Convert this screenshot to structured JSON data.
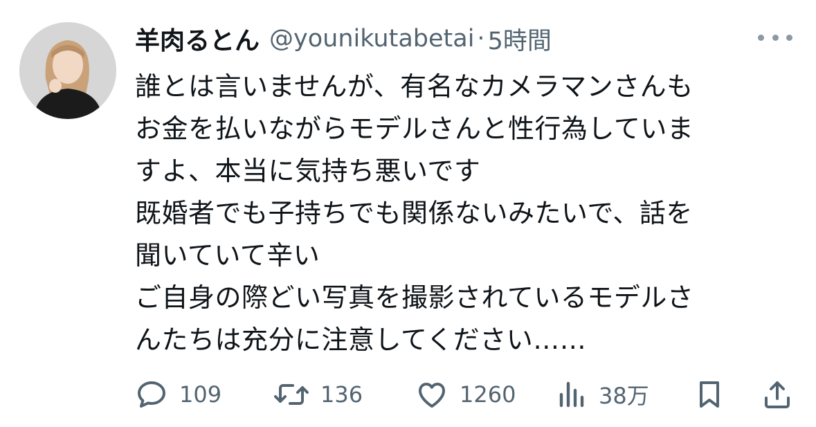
{
  "tweet": {
    "display_name": "羊肉るとん",
    "handle": "@younikutabetai",
    "separator": "·",
    "time": "5時間",
    "text_lines": [
      "誰とは言いませんが、有名なカメラマンさんも",
      "お金を払いながらモデルさんと性行為していま",
      "すよ、本当に気持ち悪いです",
      "既婚者でも子持ちでも関係ないみたいで、話を",
      "聞いていて辛い",
      "ご自身の際どい写真を撮影されているモデルさ",
      "んたちは充分に注意してください……"
    ]
  },
  "actions": {
    "reply": {
      "icon": "reply-icon",
      "count": "109"
    },
    "retweet": {
      "icon": "retweet-icon",
      "count": "136"
    },
    "like": {
      "icon": "heart-icon",
      "count": "1260"
    },
    "views": {
      "icon": "views-icon",
      "count": "38万"
    },
    "bookmark": {
      "icon": "bookmark-icon"
    },
    "share": {
      "icon": "share-icon"
    }
  },
  "colors": {
    "text": "#0f1419",
    "secondary": "#536471",
    "background": "#ffffff"
  }
}
